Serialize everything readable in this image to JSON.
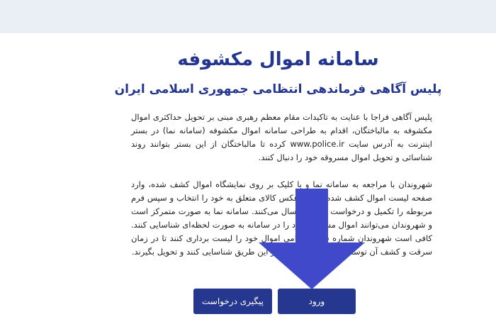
{
  "header": {
    "title": "سامانه اموال مکشوفه",
    "subtitle": "پلیس آگاهی فرماندهی انتظامی جمهوری اسلامی ایران"
  },
  "content": {
    "paragraph_1": "پلیس آگاهی فراجا با عنایت به تاکیدات مقام معظم رهبری مبنی بر تحویل حداکثری اموال مکشوفه به مالباختگان، اقدام به طراحی سامانه اموال مکشوفه (سامانه نما) در بستر اینترنت به آدرس سایت www.police.ir کرده تا مالباختگان از این بستر بتوانند روند شناسائی و تحویل اموال مسروقه خود را دنبال کنند.",
    "paragraph_2": "شهروندان با مراجعه به سامانه نما و با کلیک بر روی نمایشگاه اموال کشف شده، وارد صفحه لیست اموال کشف شده شده و عکس کالای متعلق به خود را انتخاب و سپس فرم مربوطه را تکمیل و درخواست خود را ارسال می‌کنند. سامانه نما به صورت متمرکز است و شهروندان می‌توانند اموال مسروقه خود را در سامانه به صورت لحظه‌ای شناسایی کنند. کافی است شهروندان شماره سریال تمامی اموال خود را لیست برداری کنند تا در زمان سرقت و کشف آن توسط پلیس اموال خود را از این طریق شناسایی کنند و تحویل بگیرند."
  },
  "actions": {
    "login_label": "ورود",
    "track_label": "پیگیری درخواست"
  },
  "colors": {
    "brand": "#26378f",
    "arrow": "#3f49c9",
    "top_band": "#eaeef5"
  },
  "icons": {
    "pointer": "down-arrow-icon"
  }
}
